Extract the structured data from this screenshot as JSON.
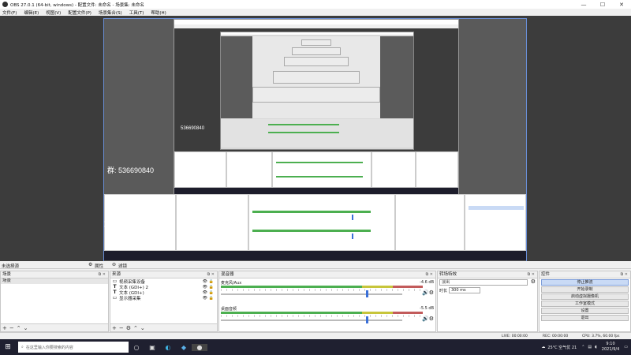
{
  "window": {
    "title": "OBS 27.0.1 (64-bit, windows) - 配置文件: 未命名 - 场景集: 未命名",
    "minimize": "—",
    "maximize": "☐",
    "close": "✕"
  },
  "menu": [
    "文件(F)",
    "编辑(E)",
    "视图(V)",
    "配置文件(P)",
    "场景集合(S)",
    "工具(T)",
    "帮助(H)"
  ],
  "preview": {
    "overlay_texts": [
      "536690840",
      "群: 536690840",
      "群: 536690840"
    ]
  },
  "docks": {
    "scenes": {
      "title": "场景",
      "items": [
        "场景"
      ],
      "no_scene_label": "未选择源",
      "properties_label": "属性",
      "filters_label": "滤镜"
    },
    "sources": {
      "title": "来源",
      "items": [
        {
          "icon": "monitor-icon",
          "label": "视频采集设备"
        },
        {
          "icon": "text-icon",
          "label": "文本 (GDI+) 2"
        },
        {
          "icon": "text-icon",
          "label": "文本 (GDI+)"
        },
        {
          "icon": "monitor-icon",
          "label": "显示器采集"
        }
      ]
    },
    "mixer": {
      "title": "混音器",
      "tracks": [
        {
          "name": "麦克风/Aux",
          "db": "-4.6 dB",
          "level": 0.68
        },
        {
          "name": "桌面音频",
          "db": "-5.5 dB",
          "level": 0.68
        }
      ]
    },
    "transitions": {
      "title": "转场特效",
      "type": "淡出",
      "duration_label": "时长",
      "duration_value": "300 ms"
    },
    "controls": {
      "title": "控件",
      "buttons": [
        "停止推流",
        "开始录制",
        "启动虚拟摄像机",
        "工作室模式",
        "设置",
        "退出"
      ]
    }
  },
  "status": {
    "live": "LIVE: 00:00:00",
    "rec": "REC: 00:00:00",
    "cpu": "CPU: 3.7%, 60.00 fps"
  },
  "taskbar": {
    "search_placeholder": "在这里输入你要搜索的内容",
    "weather": "25°C 空气优 21",
    "time": "9:10",
    "date": "2021/9/4"
  },
  "colors": {
    "accent": "#3a6fd8",
    "canvas_border": "#6a8fd8",
    "meter_green": "#4caf50",
    "meter_yellow": "#c7c53b",
    "meter_red": "#c25b5b"
  }
}
